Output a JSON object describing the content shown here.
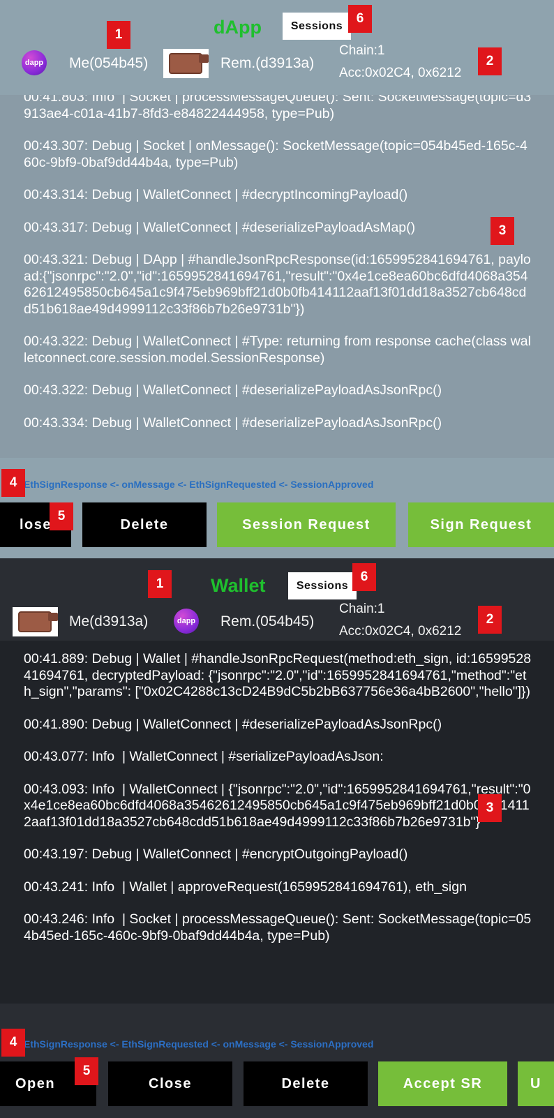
{
  "dapp": {
    "title": "dApp",
    "sessions_label": "Sessions",
    "logo_text": "dapp",
    "me": "Me(054b45)",
    "rem": "Rem.(d3913a)",
    "chain": "Chain:1",
    "acc": "Acc:0x02C4, 0x6212",
    "log": [
      "00:41.803: Info  | Socket | processMessageQueue(): Sent: SocketMessage(topic=d3913ae4-c01a-41b7-8fd3-e84822444958, type=Pub)",
      "00:43.307: Debug | Socket | onMessage(): SocketMessage(topic=054b45ed-165c-460c-9bf9-0baf9dd44b4a, type=Pub)",
      "00:43.314: Debug | WalletConnect | #decryptIncomingPayload()",
      "00:43.317: Debug | WalletConnect | #deserializePayloadAsMap()",
      "00:43.321: Debug | DApp | #handleJsonRpcResponse(id:1659952841694761, payload:{\"jsonrpc\":\"2.0\",\"id\":1659952841694761,\"result\":\"0x4e1ce8ea60bc6dfd4068a35462612495850cb645a1c9f475eb969bff21d0b0fb414112aaf13f01dd18a3527cb648cdd51b618ae49d4999112c33f86b7b26e9731b\"})",
      "00:43.322: Debug | WalletConnect | #Type: returning from response cache(class walletconnect.core.session.model.SessionResponse)",
      "00:43.322: Debug | WalletConnect | #deserializePayloadAsJsonRpc()",
      "00:43.334: Debug | WalletConnect | #deserializePayloadAsJsonRpc()"
    ],
    "flow": "EthSignResponse <- onMessage <- EthSignRequested <- SessionApproved",
    "buttons": [
      "lose",
      "Delete",
      "Session Request",
      "Sign Request"
    ]
  },
  "wallet": {
    "title": "Wallet",
    "sessions_label": "Sessions",
    "logo_text": "dapp",
    "me": "Me(d3913a)",
    "rem": "Rem.(054b45)",
    "chain": "Chain:1",
    "acc": "Acc:0x02C4, 0x6212",
    "log": [
      "00:41.889: Debug | Wallet | #handleJsonRpcRequest(method:eth_sign, id:1659952841694761, decryptedPayload: {\"jsonrpc\":\"2.0\",\"id\":1659952841694761,\"method\":\"eth_sign\",\"params\": [\"0x02C4288c13cD24B9dC5b2bB637756e36a4bB2600\",\"hello\"]})",
      "00:41.890: Debug | WalletConnect | #deserializePayloadAsJsonRpc()",
      "00:43.077: Info  | WalletConnect | #serializePayloadAsJson:",
      "00:43.093: Info  | WalletConnect | {\"jsonrpc\":\"2.0\",\"id\":1659952841694761,\"result\":\"0x4e1ce8ea60bc6dfd4068a35462612495850cb645a1c9f475eb969bff21d0b0fb414112aaf13f01dd18a3527cb648cdd51b618ae49d4999112c33f86b7b26e9731b\"}",
      "00:43.197: Debug | WalletConnect | #encryptOutgoingPayload()",
      "00:43.241: Info  | Wallet | approveRequest(1659952841694761), eth_sign",
      "00:43.246: Info  | Socket | processMessageQueue(): Sent: SocketMessage(topic=054b45ed-165c-460c-9bf9-0baf9dd44b4a, type=Pub)"
    ],
    "flow": "EthSignResponse <- EthSignRequested <- onMessage <- SessionApproved",
    "buttons": [
      "Open",
      "Close",
      "Delete",
      "Accept SR",
      "U"
    ]
  },
  "badges": {
    "dapp": [
      "1",
      "2",
      "3",
      "4",
      "5",
      "6"
    ],
    "wallet": [
      "1",
      "2",
      "3",
      "4",
      "5",
      "6"
    ]
  }
}
